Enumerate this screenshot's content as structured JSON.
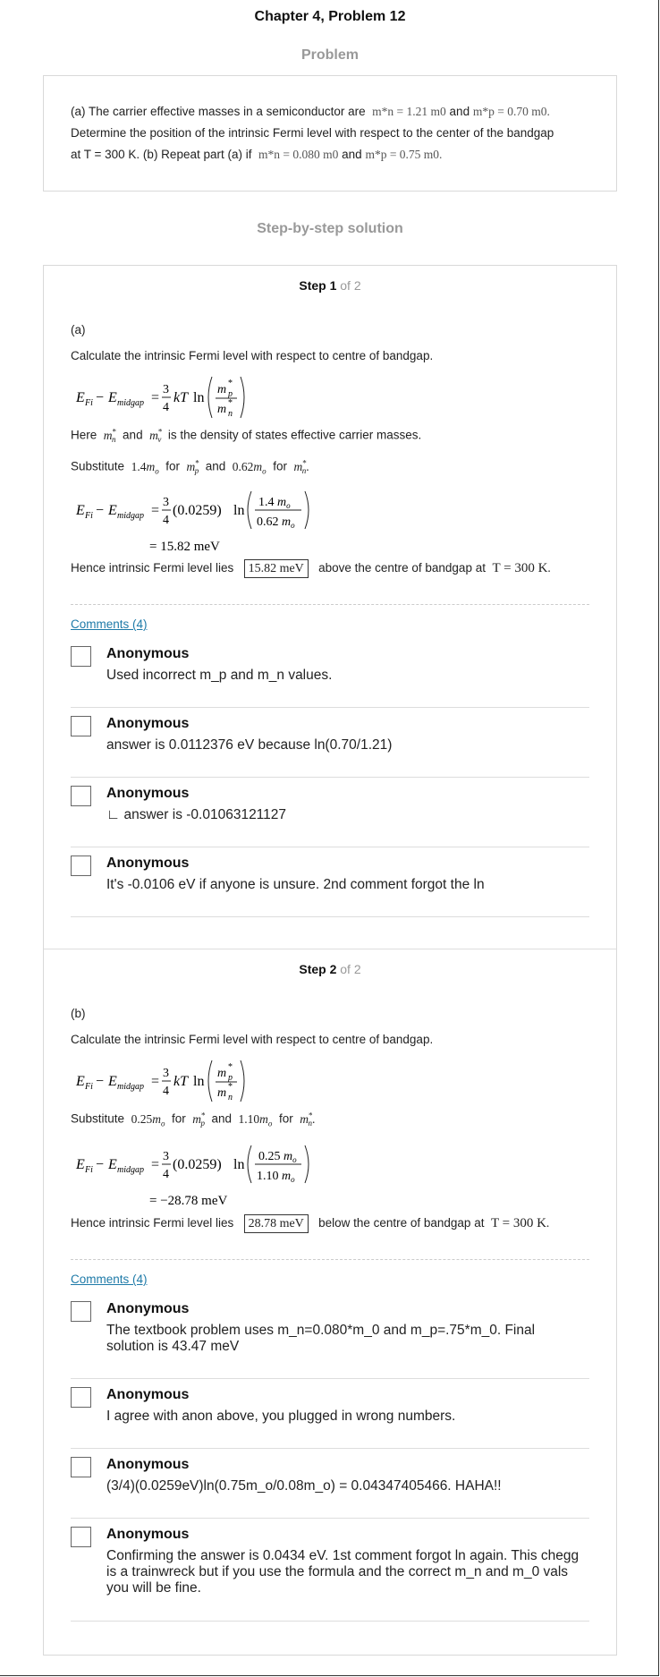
{
  "header": {
    "title": "Chapter 4, Problem 12",
    "problem_heading": "Problem",
    "solution_heading": "Step-by-step solution"
  },
  "problem": {
    "line1_pre": "(a) The carrier effective masses in a semiconductor are",
    "mn_a": "m*n = 1.21 m0",
    "and1": "and",
    "mp_a": "m*p = 0.70 m0.",
    "line2": "Determine the position of the intrinsic Fermi level with respect to the center of the bandgap",
    "line3_pre": "at T = 300 K. (b) Repeat part (a) if",
    "mn_b": "m*n = 0.080 m0",
    "and2": "and",
    "mp_b": "m*p = 0.75 m0."
  },
  "steps": [
    {
      "label": "Step 1",
      "of": "of 2",
      "part": "(a)",
      "intro": "Calculate the intrinsic Fermi level with respect to centre of bandgap.",
      "here": {
        "pre": "Here",
        "and": "and",
        "post": "is the density of states effective carrier masses."
      },
      "subst": {
        "word": "Substitute",
        "v1": "1.4",
        "for1": "for",
        "and": "and",
        "v2": "0.62",
        "for2": "for"
      },
      "calc": {
        "kt": "(0.0259)",
        "num": "1.4",
        "den": "0.62",
        "result": "= 15.82 meV"
      },
      "conclusion": {
        "pre": "Hence intrinsic Fermi level lies",
        "value": "15.82 meV",
        "post": "above the centre of bandgap at",
        "temp": "T = 300 K"
      },
      "comments_link": "Comments (4)",
      "comments": [
        {
          "author": "Anonymous",
          "text": "Used incorrect m_p and m_n values."
        },
        {
          "author": "Anonymous",
          "text": "answer is 0.0112376 eV because ln(0.70/1.21)"
        },
        {
          "author": "Anonymous",
          "text": "∟ answer is -0.01063121127"
        },
        {
          "author": "Anonymous",
          "text": "It's -0.0106 eV if anyone is unsure. 2nd comment forgot the ln"
        }
      ]
    },
    {
      "label": "Step 2",
      "of": "of 2",
      "part": "(b)",
      "intro": "Calculate the intrinsic Fermi level with respect to centre of bandgap.",
      "subst": {
        "word": "Substitute",
        "v1": "0.25",
        "for1": "for",
        "and": "and",
        "v2": "1.10",
        "for2": "for"
      },
      "calc": {
        "kt": "(0.0259)",
        "num": "0.25",
        "den": "1.10",
        "result": "= −28.78 meV"
      },
      "conclusion": {
        "pre": "Hence intrinsic Fermi level lies",
        "value": "28.78 meV",
        "post": "below the centre of bandgap at",
        "temp": "T = 300 K"
      },
      "comments_link": "Comments (4)",
      "comments": [
        {
          "author": "Anonymous",
          "text": "The textbook problem uses m_n=0.080*m_0 and m_p=.75*m_0. Final solution is 43.47 meV"
        },
        {
          "author": "Anonymous",
          "text": "I agree with anon above, you plugged in wrong numbers."
        },
        {
          "author": "Anonymous",
          "text": "(3/4)(0.0259eV)ln(0.75m_o/0.08m_o) = 0.04347405466. HAHA!!"
        },
        {
          "author": "Anonymous",
          "text": "Confirming the answer is 0.0434 eV. 1st comment forgot ln again. This chegg is a trainwreck but if you use the formula and the correct m_n and m_0 vals you will be fine."
        }
      ]
    }
  ]
}
